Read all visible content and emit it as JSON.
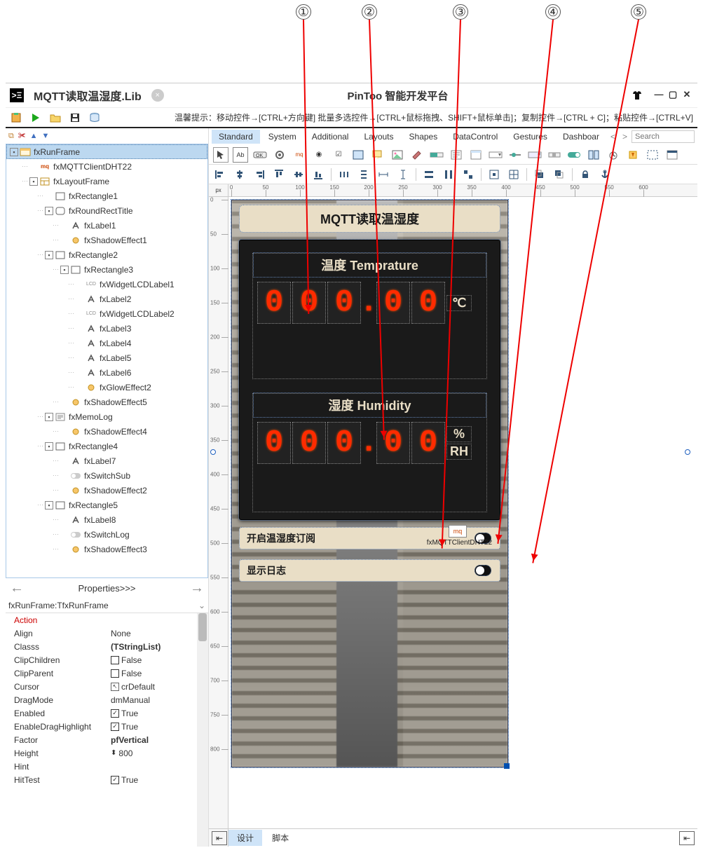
{
  "annotations": [
    "①",
    "②",
    "③",
    "④",
    "⑤"
  ],
  "header": {
    "tab_title": "MQTT读取温湿度.Lib",
    "app_title": "PinToo 智能开发平台",
    "hint": "温馨提示：移动控件→[CTRL+方向键]    批量多选控件→[CTRL+鼠标拖拽、SHIFT+鼠标单击]；复制控件→[CTRL + C]；粘贴控件→[CTRL+V]"
  },
  "tree": [
    {
      "d": 0,
      "exp": "▾",
      "icon": "frame",
      "label": "fxRunFrame",
      "sel": true
    },
    {
      "d": 1,
      "exp": "",
      "icon": "mq",
      "label": "fxMQTTClientDHT22"
    },
    {
      "d": 1,
      "exp": "▾",
      "icon": "layout",
      "label": "fxLayoutFrame"
    },
    {
      "d": 2,
      "exp": "",
      "icon": "rect",
      "label": "fxRectangle1"
    },
    {
      "d": 2,
      "exp": "▾",
      "icon": "rrect",
      "label": "fxRoundRectTitle"
    },
    {
      "d": 3,
      "exp": "",
      "icon": "label",
      "label": "fxLabel1"
    },
    {
      "d": 3,
      "exp": "",
      "icon": "effect",
      "label": "fxShadowEffect1"
    },
    {
      "d": 2,
      "exp": "▾",
      "icon": "rect",
      "label": "fxRectangle2"
    },
    {
      "d": 3,
      "exp": "▾",
      "icon": "rect",
      "label": "fxRectangle3"
    },
    {
      "d": 4,
      "exp": "",
      "icon": "lcd",
      "label": "fxWidgetLCDLabel1"
    },
    {
      "d": 4,
      "exp": "",
      "icon": "label",
      "label": "fxLabel2"
    },
    {
      "d": 4,
      "exp": "",
      "icon": "lcd",
      "label": "fxWidgetLCDLabel2"
    },
    {
      "d": 4,
      "exp": "",
      "icon": "label",
      "label": "fxLabel3"
    },
    {
      "d": 4,
      "exp": "",
      "icon": "label",
      "label": "fxLabel4"
    },
    {
      "d": 4,
      "exp": "",
      "icon": "label",
      "label": "fxLabel5"
    },
    {
      "d": 4,
      "exp": "",
      "icon": "label",
      "label": "fxLabel6"
    },
    {
      "d": 4,
      "exp": "",
      "icon": "effect",
      "label": "fxGlowEffect2"
    },
    {
      "d": 3,
      "exp": "",
      "icon": "effect",
      "label": "fxShadowEffect5"
    },
    {
      "d": 2,
      "exp": "▾",
      "icon": "memo",
      "label": "fxMemoLog"
    },
    {
      "d": 3,
      "exp": "",
      "icon": "effect",
      "label": "fxShadowEffect4"
    },
    {
      "d": 2,
      "exp": "▾",
      "icon": "rect",
      "label": "fxRectangle4"
    },
    {
      "d": 3,
      "exp": "",
      "icon": "label",
      "label": "fxLabel7"
    },
    {
      "d": 3,
      "exp": "",
      "icon": "switch",
      "label": "fxSwitchSub"
    },
    {
      "d": 3,
      "exp": "",
      "icon": "effect",
      "label": "fxShadowEffect2"
    },
    {
      "d": 2,
      "exp": "▾",
      "icon": "rect",
      "label": "fxRectangle5"
    },
    {
      "d": 3,
      "exp": "",
      "icon": "label",
      "label": "fxLabel8"
    },
    {
      "d": 3,
      "exp": "",
      "icon": "switch",
      "label": "fxSwitchLog"
    },
    {
      "d": 3,
      "exp": "",
      "icon": "effect",
      "label": "fxShadowEffect3"
    }
  ],
  "props_nav": "Properties>>>",
  "props_selector": "fxRunFrame:TfxRunFrame",
  "properties": [
    {
      "name": "Action",
      "val": "",
      "cls": "action"
    },
    {
      "name": "Align",
      "val": "None"
    },
    {
      "name": "Classs",
      "val": "(TStringList)",
      "bold": true
    },
    {
      "name": "ClipChildren",
      "val": "False",
      "chk": false
    },
    {
      "name": "ClipParent",
      "val": "False",
      "chk": false
    },
    {
      "name": "Cursor",
      "val": "crDefault",
      "icon": "cursor"
    },
    {
      "name": "DragMode",
      "val": "dmManual"
    },
    {
      "name": "Enabled",
      "val": "True",
      "chk": true
    },
    {
      "name": "EnableDragHighlight",
      "val": "True",
      "chk": true
    },
    {
      "name": "Factor",
      "val": "pfVertical",
      "bold": true
    },
    {
      "name": "Height",
      "val": "800",
      "icon": "height"
    },
    {
      "name": "Hint",
      "val": ""
    },
    {
      "name": "HitTest",
      "val": "True",
      "chk": true
    }
  ],
  "palette_tabs": [
    "Standard",
    "System",
    "Additional",
    "Layouts",
    "Shapes",
    "DataControl",
    "Gestures",
    "Dashboar"
  ],
  "search_placeholder": "Search",
  "design": {
    "title": "MQTT读取温湿度",
    "temp_label": "温度 Temprature",
    "temp_value": "000.00",
    "temp_unit": "℃",
    "humi_label": "湿度 Humidity",
    "humi_value": "000.00",
    "humi_unit1": "%",
    "humi_unit2": "RH",
    "ctrl1": "开启温湿度订阅",
    "ctrl2": "显示日志",
    "mq_badge": "mq",
    "mq_label": "fxMQTTClientDHT22"
  },
  "ruler_h": [
    0,
    50,
    100,
    150,
    200,
    250,
    300,
    350,
    400,
    450,
    500,
    550,
    600
  ],
  "ruler_v": [
    0,
    50,
    100,
    150,
    200,
    250,
    300,
    350,
    400,
    450,
    500,
    550,
    600,
    650,
    700,
    750,
    800
  ],
  "footer": {
    "design": "设计",
    "script": "脚本"
  }
}
